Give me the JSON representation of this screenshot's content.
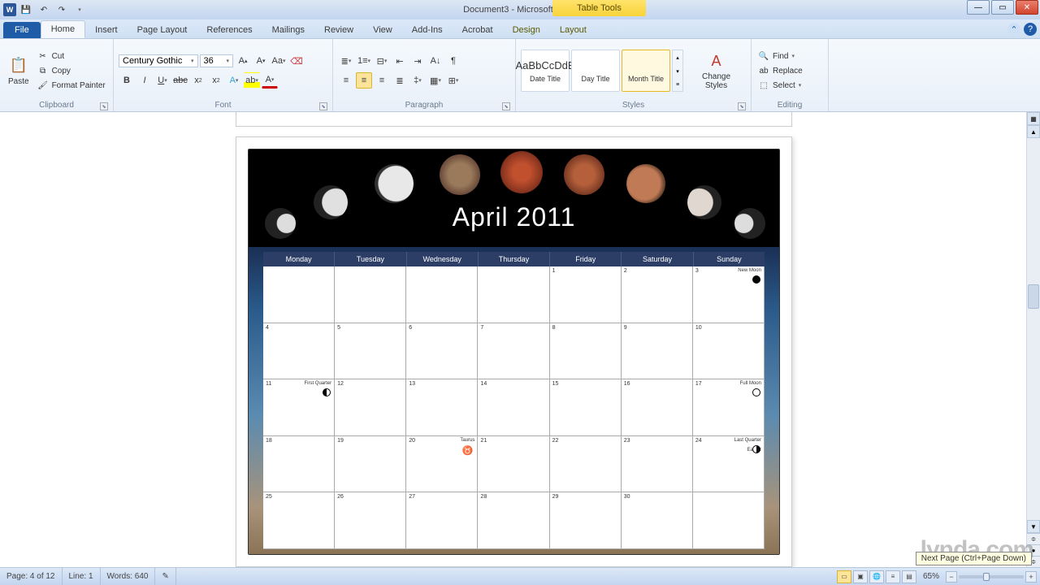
{
  "window": {
    "title": "Document3 - Microsoft Word",
    "contextual_tab_group": "Table Tools"
  },
  "tabs": {
    "file": "File",
    "home": "Home",
    "insert": "Insert",
    "page_layout": "Page Layout",
    "references": "References",
    "mailings": "Mailings",
    "review": "Review",
    "view": "View",
    "addins": "Add-Ins",
    "acrobat": "Acrobat",
    "design": "Design",
    "layout": "Layout"
  },
  "ribbon": {
    "clipboard": {
      "label": "Clipboard",
      "paste": "Paste",
      "cut": "Cut",
      "copy": "Copy",
      "format_painter": "Format Painter"
    },
    "font": {
      "label": "Font",
      "name": "Century Gothic",
      "size": "36"
    },
    "paragraph": {
      "label": "Paragraph"
    },
    "styles": {
      "label": "Styles",
      "items": [
        {
          "preview": "AaBbCcDdE",
          "name": "Date Title"
        },
        {
          "preview": "",
          "name": "Day Title"
        },
        {
          "preview": "",
          "name": "Month Title"
        }
      ],
      "change": "Change Styles"
    },
    "editing": {
      "label": "Editing",
      "find": "Find",
      "replace": "Replace",
      "select": "Select"
    }
  },
  "calendar": {
    "title": "April 2011",
    "days": [
      "Monday",
      "Tuesday",
      "Wednesday",
      "Thursday",
      "Friday",
      "Saturday",
      "Sunday"
    ],
    "weeks": [
      [
        {
          "n": ""
        },
        {
          "n": ""
        },
        {
          "n": ""
        },
        {
          "n": ""
        },
        {
          "n": "1"
        },
        {
          "n": "2"
        },
        {
          "n": "3",
          "ev": "New Moon",
          "ph": "new"
        }
      ],
      [
        {
          "n": "4"
        },
        {
          "n": "5"
        },
        {
          "n": "6"
        },
        {
          "n": "7"
        },
        {
          "n": "8"
        },
        {
          "n": "9"
        },
        {
          "n": "10"
        }
      ],
      [
        {
          "n": "11",
          "ev": "First Quarter",
          "ph": "fq"
        },
        {
          "n": "12"
        },
        {
          "n": "13"
        },
        {
          "n": "14"
        },
        {
          "n": "15"
        },
        {
          "n": "16"
        },
        {
          "n": "17",
          "ev": "Full Moon",
          "ph": "full"
        }
      ],
      [
        {
          "n": "18"
        },
        {
          "n": "19"
        },
        {
          "n": "20",
          "ev": "Taurus",
          "taurus": true
        },
        {
          "n": "21"
        },
        {
          "n": "22"
        },
        {
          "n": "23"
        },
        {
          "n": "24",
          "ev": "Last Quarter",
          "ev2": "Easter",
          "ph": "lq"
        }
      ],
      [
        {
          "n": "25"
        },
        {
          "n": "26"
        },
        {
          "n": "27"
        },
        {
          "n": "28"
        },
        {
          "n": "29"
        },
        {
          "n": "30"
        },
        {
          "n": ""
        }
      ]
    ]
  },
  "status": {
    "page": "Page: 4 of 12",
    "line": "Line: 1",
    "words": "Words: 640",
    "zoom": "65%"
  },
  "tooltip": "Next Page (Ctrl+Page Down)",
  "watermark": "lynda.com"
}
